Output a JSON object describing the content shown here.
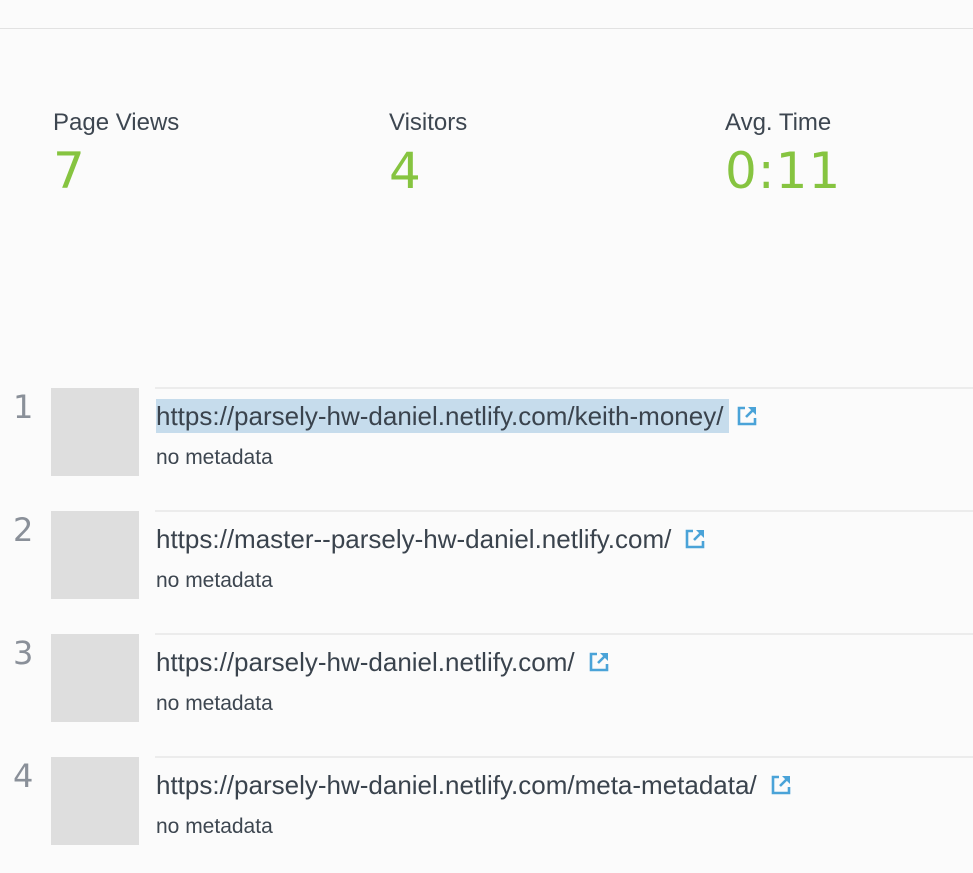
{
  "stats": {
    "page_views": {
      "label": "Page Views",
      "value": "7"
    },
    "visitors": {
      "label": "Visitors",
      "value": "4"
    },
    "avg_time": {
      "label": "Avg. Time",
      "value": "0:11"
    }
  },
  "colors": {
    "accent_green": "#86c440",
    "link_icon_blue": "#4aa3d8",
    "selection_blue": "#c6dcec"
  },
  "pages": [
    {
      "rank": "1",
      "url": "https://parsely-hw-daniel.netlify.com/keith-money/",
      "meta": "no metadata",
      "icon": "external-link-icon",
      "selected": true
    },
    {
      "rank": "2",
      "url": "https://master--parsely-hw-daniel.netlify.com/",
      "meta": "no metadata",
      "icon": "external-link-icon",
      "selected": false
    },
    {
      "rank": "3",
      "url": "https://parsely-hw-daniel.netlify.com/",
      "meta": "no metadata",
      "icon": "external-link-icon",
      "selected": false
    },
    {
      "rank": "4",
      "url": "https://parsely-hw-daniel.netlify.com/meta-metadata/",
      "meta": "no metadata",
      "icon": "external-link-icon",
      "selected": false
    }
  ]
}
